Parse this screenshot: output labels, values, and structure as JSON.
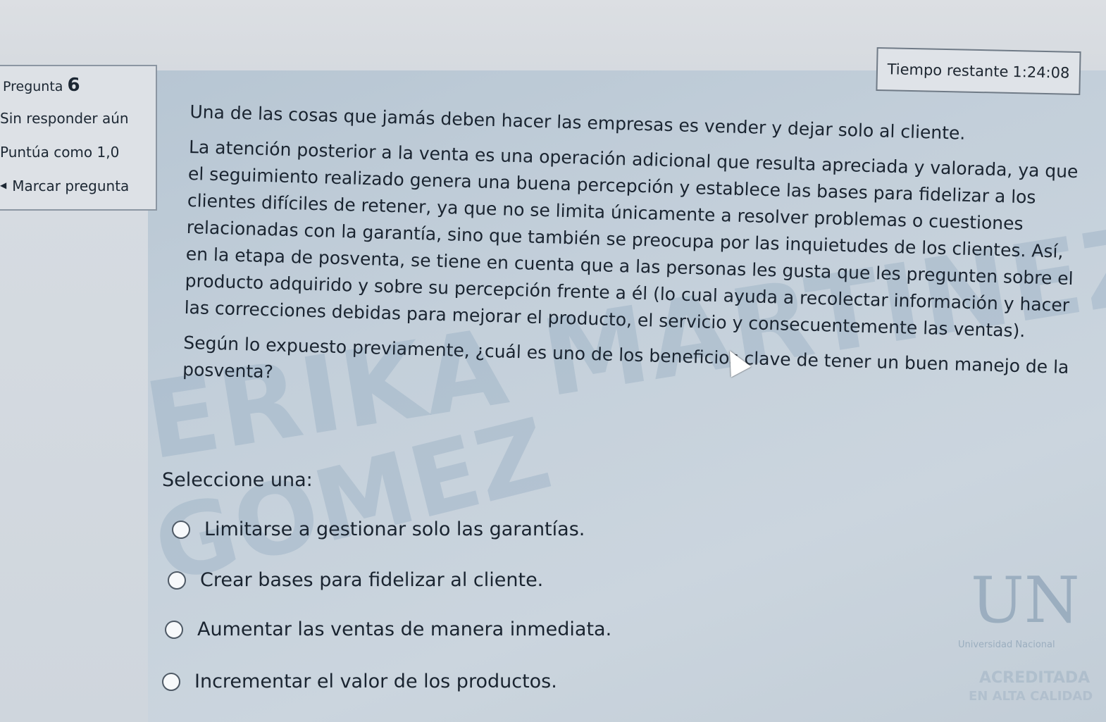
{
  "timer": {
    "label": "Tiempo restante",
    "value": "1:24:08"
  },
  "question_info": {
    "label": "Pregunta",
    "number": "6",
    "state": "Sin responder aún",
    "grade": "Puntúa como 1,0",
    "flag_label": "Marcar pregunta",
    "flag_icon": "flag-icon"
  },
  "question": {
    "paragraph1": "Una de las cosas que jamás deben hacer las empresas es vender y dejar solo al cliente.",
    "paragraph2": "La atención posterior a la venta es una operación adicional que resulta apreciada y valorada, ya que el seguimiento realizado genera una buena percepción y establece las bases para fidelizar a los clientes difíciles de retener, ya que no se limita únicamente a resolver problemas o cuestiones relacionadas con la garantía, sino que también se preocupa por las inquietudes de los clientes. Así, en la etapa de posventa, se tiene en cuenta que a las personas les gusta que les pregunten sobre el producto adquirido y sobre su percepción frente a él (lo cual ayuda a recolectar información y hacer las correcciones debidas para mejorar el producto, el servicio y consecuentemente las ventas).",
    "paragraph3": "Según lo expuesto previamente, ¿cuál es uno de los beneficios clave de tener un buen manejo de la posventa?"
  },
  "answer": {
    "prompt": "Seleccione una:",
    "options": [
      "Limitarse a gestionar solo las garantías.",
      "Crear bases para fidelizar al cliente.",
      "Aumentar las ventas de manera inmediata.",
      "Incrementar el valor de los productos."
    ]
  },
  "watermark": {
    "line1": "ERIKA MARTINEZ",
    "line2": "GOMEZ"
  },
  "logo": {
    "mark": "UN",
    "subtitle": "Universidad Nacional",
    "accreditation": "ACREDITADA",
    "accreditation2": "EN ALTA CALIDAD"
  }
}
